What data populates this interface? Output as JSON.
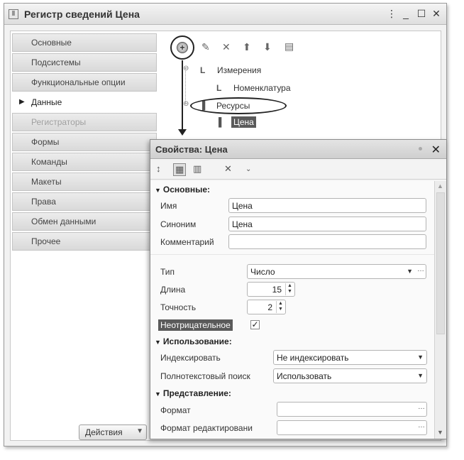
{
  "window": {
    "icon": "window-icon",
    "title": "Регистр сведений Цена",
    "controls": {
      "menu": "⋮",
      "minimize": "_",
      "maximize": "☐",
      "close": "✕"
    }
  },
  "nav": {
    "items": [
      {
        "label": "Основные",
        "state": "normal"
      },
      {
        "label": "Подсистемы",
        "state": "normal"
      },
      {
        "label": "Функциональные опции",
        "state": "normal"
      },
      {
        "label": "Данные",
        "state": "active"
      },
      {
        "label": "Регистраторы",
        "state": "disabled"
      },
      {
        "label": "Формы",
        "state": "normal"
      },
      {
        "label": "Команды",
        "state": "normal"
      },
      {
        "label": "Макеты",
        "state": "normal"
      },
      {
        "label": "Права",
        "state": "normal"
      },
      {
        "label": "Обмен данными",
        "state": "normal"
      },
      {
        "label": "Прочее",
        "state": "normal"
      }
    ],
    "actions_label": "Действия"
  },
  "toolbar": {
    "icons": [
      "add-icon",
      "edit-pencil-icon",
      "delete-x-icon",
      "move-up-icon",
      "move-down-icon",
      "list-icon"
    ]
  },
  "tree": {
    "measurements": "Измерения",
    "nomenclature": "Номенклатура",
    "resources": "Ресурсы",
    "price": "Цена"
  },
  "props": {
    "title": "Свойства: Цена",
    "close": "✕",
    "sections": {
      "main": "Основные:",
      "usage": "Использование:",
      "presentation": "Представление:"
    },
    "fields": {
      "name_label": "Имя",
      "name_value": "Цена",
      "synonym_label": "Синоним",
      "synonym_value": "Цена",
      "comment_label": "Комментарий",
      "comment_value": "",
      "type_label": "Тип",
      "type_value": "Число",
      "length_label": "Длина",
      "length_value": "15",
      "precision_label": "Точность",
      "precision_value": "2",
      "nonnegative_label": "Неотрицательное",
      "nonnegative_checked": true,
      "index_label": "Индексировать",
      "index_value": "Не индексировать",
      "fulltext_label": "Полнотекстовый поиск",
      "fulltext_value": "Использовать",
      "format_label": "Формат",
      "format_value": "",
      "edit_format_label": "Формат редактировани",
      "edit_format_value": ""
    }
  },
  "colors": {
    "selection": "#5a5a5a",
    "window_bg": "#f2f2f2",
    "annotation": "#222222"
  }
}
